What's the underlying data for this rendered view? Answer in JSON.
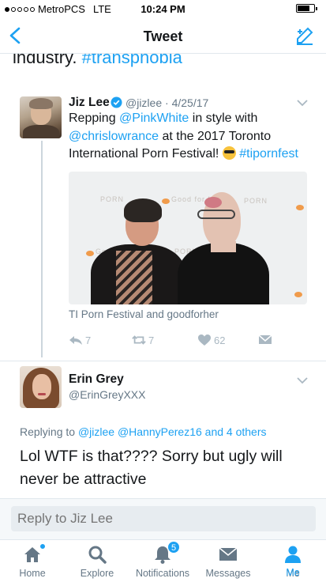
{
  "status_bar": {
    "carrier": "MetroPCS",
    "network": "LTE",
    "time": "10:24 PM"
  },
  "nav": {
    "title": "Tweet"
  },
  "partial_tweet": {
    "text": "industry. ",
    "hashtag": "#transphobia"
  },
  "quoted_tweet": {
    "name": "Jiz Lee",
    "handle": "@jizlee",
    "date": "· 4/25/17",
    "text_parts": {
      "p1": "Repping ",
      "m1": "@PinkWhite",
      "p2": " in style with ",
      "m2": "@chrislowrance",
      "p3": " at the 2017 Toronto International Porn Festival! ",
      "tag": "#tipornfest"
    },
    "caption": "TI Porn Festival and goodforher",
    "reply_count": "7",
    "retweet_count": "7",
    "like_count": "62",
    "photo_backdrop": [
      "PORN",
      "Good for Her",
      "PORN",
      "Good for her",
      "PORN"
    ]
  },
  "reply_tweet": {
    "name": "Erin Grey",
    "handle": "@ErinGreyXXX",
    "replying_label": "Replying to ",
    "replying_to": "@jizlee @HannyPerez16 and 4 others",
    "text": "Lol WTF is that???? Sorry but ugly will never be attractive"
  },
  "reply_box": {
    "placeholder": "Reply to Jiz Lee"
  },
  "tabs": [
    {
      "label": "Home",
      "icon": "home-icon"
    },
    {
      "label": "Explore",
      "icon": "search-icon"
    },
    {
      "label": "Notifications",
      "icon": "bell-icon",
      "badge": "5"
    },
    {
      "label": "Messages",
      "icon": "envelope-icon"
    },
    {
      "label": "Me",
      "icon": "person-icon"
    }
  ],
  "colors": {
    "accent": "#1da1f2",
    "muted": "#657786",
    "text": "#14171a"
  }
}
